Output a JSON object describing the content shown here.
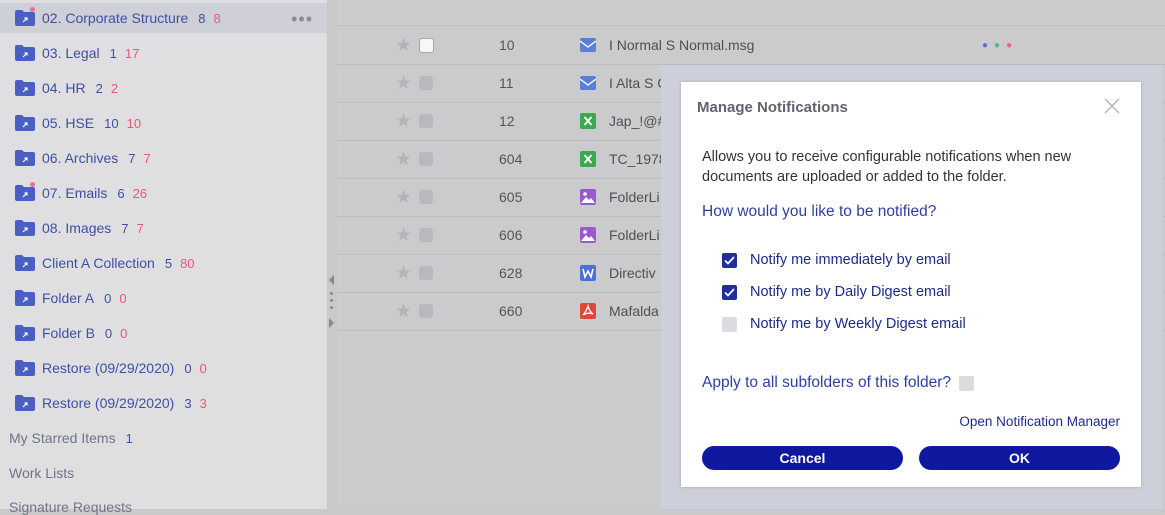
{
  "sidebar": {
    "folders": [
      {
        "label": "02. Corporate Structure",
        "c1": "8",
        "c2": "8",
        "dot": true,
        "active": true
      },
      {
        "label": "03. Legal",
        "c1": "1",
        "c2": "17",
        "dot": false
      },
      {
        "label": "04. HR",
        "c1": "2",
        "c2": "2",
        "dot": false
      },
      {
        "label": "05. HSE",
        "c1": "10",
        "c2": "10",
        "dot": false
      },
      {
        "label": "06. Archives",
        "c1": "7",
        "c2": "7",
        "dot": false
      },
      {
        "label": "07. Emails",
        "c1": "6",
        "c2": "26",
        "dot": true
      },
      {
        "label": "08. Images",
        "c1": "7",
        "c2": "7",
        "dot": false
      },
      {
        "label": "Client A Collection",
        "c1": "5",
        "c2": "80",
        "dot": false
      },
      {
        "label": "Folder A",
        "c1": "0",
        "c2": "0",
        "dot": false
      },
      {
        "label": "Folder B",
        "c1": "0",
        "c2": "0",
        "dot": false
      },
      {
        "label": "Restore (09/29/2020)",
        "c1": "0",
        "c2": "0",
        "dot": false
      },
      {
        "label": "Restore (09/29/2020)",
        "c1": "3",
        "c2": "3",
        "dot": false
      }
    ],
    "more_icon": "more-horizontal-icon",
    "starred_label": "My Starred Items",
    "starred_count": "1",
    "worklists_label": "Work Lists",
    "signature_label": "Signature Requests"
  },
  "documents": [
    {
      "id": "10",
      "name": "I Normal S Normal.msg",
      "icon": "email",
      "color": "#5b7fd6",
      "check_white": true
    },
    {
      "id": "11",
      "name": "I Alta S C",
      "icon": "email",
      "color": "#5b7fd6"
    },
    {
      "id": "12",
      "name": "Jap_!@#",
      "icon": "excel",
      "color": "#3aa850"
    },
    {
      "id": "604",
      "name": "TC_1978",
      "icon": "excel",
      "color": "#3aa850"
    },
    {
      "id": "605",
      "name": "FolderLi",
      "icon": "image",
      "color": "#9b59d0"
    },
    {
      "id": "606",
      "name": "FolderLi",
      "icon": "image",
      "color": "#9b59d0"
    },
    {
      "id": "628",
      "name": "Directiv",
      "icon": "word",
      "color": "#4a6fd6"
    },
    {
      "id": "660",
      "name": "Mafalda",
      "icon": "pdf",
      "color": "#e0463a"
    }
  ],
  "row_status_colors": [
    "#5b6fd0",
    "#4cc07a",
    "#e8608a"
  ],
  "dialog": {
    "title": "Manage Notifications",
    "description": "Allows you to receive configurable notifications when new documents are uploaded or added to the folder.",
    "question": "How would you like to be notified?",
    "options": [
      {
        "label": "Notify me immediately by email",
        "checked": true
      },
      {
        "label": "Notify me by Daily Digest email",
        "checked": true
      },
      {
        "label": "Notify me by Weekly Digest email",
        "checked": false
      }
    ],
    "apply_label": "Apply to all subfolders of this folder?",
    "apply_checked": false,
    "link_label": "Open Notification Manager",
    "cancel_label": "Cancel",
    "ok_label": "OK"
  }
}
